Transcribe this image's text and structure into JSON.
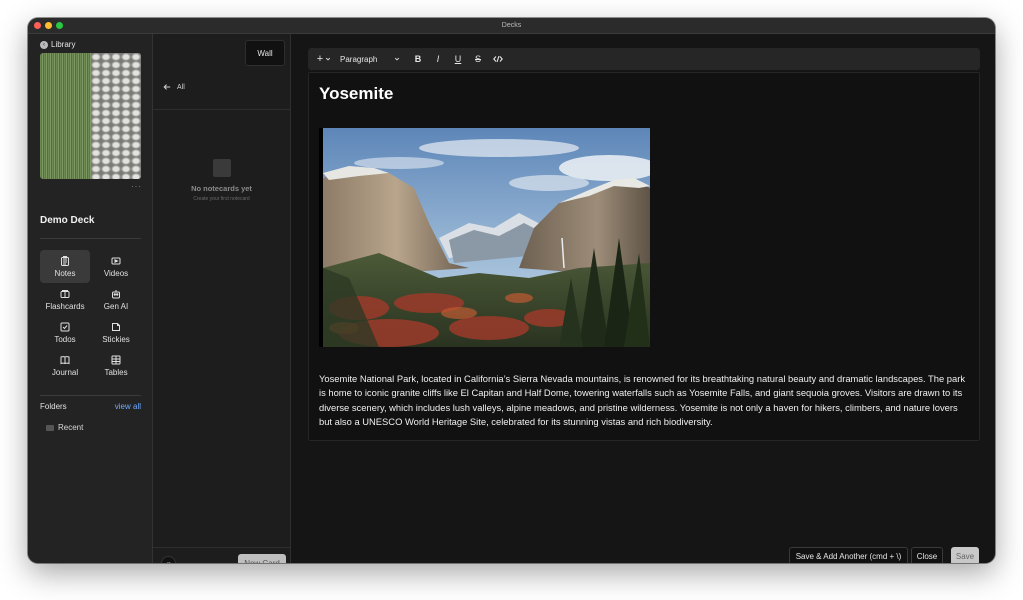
{
  "window": {
    "title": "Decks"
  },
  "traffic": {
    "red": "#ff5f57",
    "yellow": "#febc2e",
    "green": "#28c840"
  },
  "sidebar": {
    "library_label": "Library",
    "more_label": "···",
    "deck_title": "Demo Deck",
    "nav": [
      {
        "label": "Notes",
        "icon": "notes-icon"
      },
      {
        "label": "Videos",
        "icon": "video-icon"
      },
      {
        "label": "Flashcards",
        "icon": "flashcards-icon"
      },
      {
        "label": "Gen AI",
        "icon": "robot-icon"
      },
      {
        "label": "Todos",
        "icon": "checkbox-icon"
      },
      {
        "label": "Stickies",
        "icon": "sticky-note-icon"
      },
      {
        "label": "Journal",
        "icon": "book-icon"
      },
      {
        "label": "Tables",
        "icon": "table-icon"
      }
    ],
    "folders_label": "Folders",
    "view_all_label": "view all",
    "folder_items": [
      "Recent"
    ]
  },
  "middle": {
    "wall_label": "Wall",
    "back_label": "All",
    "empty_title": "No notecards yet",
    "empty_subtitle": "Create your first notecard",
    "new_card_label": "New Card"
  },
  "toolbar": {
    "block_type": "Paragraph",
    "bold": "B",
    "italic": "I",
    "underline": "U",
    "strike": "S"
  },
  "document": {
    "title": "Yosemite",
    "body": "Yosemite National Park, located in California’s Sierra Nevada mountains, is renowned for its breathtaking natural beauty and dramatic landscapes. The park is home to iconic granite cliffs like El Capitan and Half Dome, towering waterfalls such as Yosemite Falls, and giant sequoia groves. Visitors are drawn to its diverse scenery, which includes lush valleys, alpine meadows, and pristine wilderness. Yosemite is not only a haven for hikers, climbers, and nature lovers but also a UNESCO World Heritage Site, celebrated for its stunning vistas and rich biodiversity."
  },
  "actions": {
    "save_add_another": "Save & Add Another (cmd + \\)",
    "close": "Close",
    "save": "Save"
  },
  "colors": {
    "accent_link": "#6fa8ff",
    "background": "#151515"
  }
}
